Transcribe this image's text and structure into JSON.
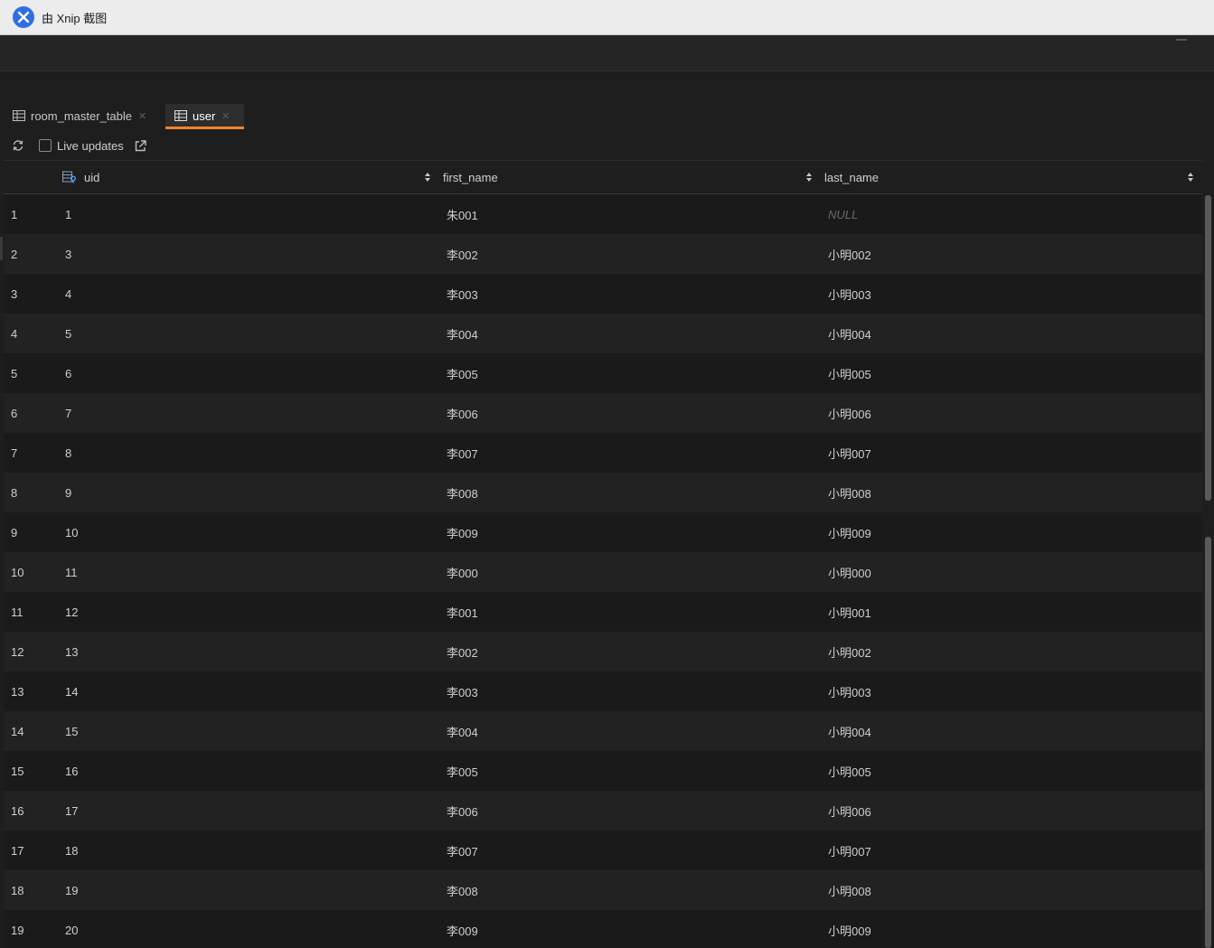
{
  "titlebar": {
    "title": "由 Xnip 截图"
  },
  "tabs": [
    {
      "label": "room_master_table",
      "active": false
    },
    {
      "label": "user",
      "active": true
    }
  ],
  "toolbar": {
    "live_updates_label": "Live updates",
    "live_updates_checked": false
  },
  "columns": [
    "uid",
    "first_name",
    "last_name"
  ],
  "rows": [
    {
      "n": "1",
      "uid": "1",
      "first_name": "朱001",
      "last_name": "NULL",
      "last_null": true
    },
    {
      "n": "2",
      "uid": "3",
      "first_name": "李002",
      "last_name": "小明002"
    },
    {
      "n": "3",
      "uid": "4",
      "first_name": "李003",
      "last_name": "小明003"
    },
    {
      "n": "4",
      "uid": "5",
      "first_name": "李004",
      "last_name": "小明004"
    },
    {
      "n": "5",
      "uid": "6",
      "first_name": "李005",
      "last_name": "小明005"
    },
    {
      "n": "6",
      "uid": "7",
      "first_name": "李006",
      "last_name": "小明006"
    },
    {
      "n": "7",
      "uid": "8",
      "first_name": "李007",
      "last_name": "小明007"
    },
    {
      "n": "8",
      "uid": "9",
      "first_name": "李008",
      "last_name": "小明008"
    },
    {
      "n": "9",
      "uid": "10",
      "first_name": "李009",
      "last_name": "小明009"
    },
    {
      "n": "10",
      "uid": "11",
      "first_name": "李000",
      "last_name": "小明000"
    },
    {
      "n": "11",
      "uid": "12",
      "first_name": "李001",
      "last_name": "小明001"
    },
    {
      "n": "12",
      "uid": "13",
      "first_name": "李002",
      "last_name": "小明002"
    },
    {
      "n": "13",
      "uid": "14",
      "first_name": "李003",
      "last_name": "小明003"
    },
    {
      "n": "14",
      "uid": "15",
      "first_name": "李004",
      "last_name": "小明004"
    },
    {
      "n": "15",
      "uid": "16",
      "first_name": "李005",
      "last_name": "小明005"
    },
    {
      "n": "16",
      "uid": "17",
      "first_name": "李006",
      "last_name": "小明006"
    },
    {
      "n": "17",
      "uid": "18",
      "first_name": "李007",
      "last_name": "小明007"
    },
    {
      "n": "18",
      "uid": "19",
      "first_name": "李008",
      "last_name": "小明008"
    },
    {
      "n": "19",
      "uid": "20",
      "first_name": "李009",
      "last_name": "小明009"
    }
  ],
  "colors": {
    "accent": "#f0832d",
    "background": "#1e1e1e"
  },
  "icons": {
    "app": "xnip-logo-icon",
    "table": "table-icon",
    "close": "close-icon",
    "refresh": "refresh-icon",
    "external": "external-link-icon",
    "key": "primary-key-icon",
    "sort": "sort-icon"
  }
}
